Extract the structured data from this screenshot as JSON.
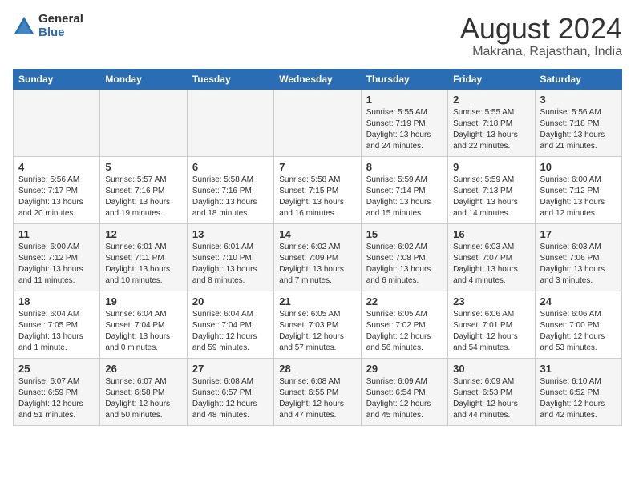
{
  "logo": {
    "general": "General",
    "blue": "Blue"
  },
  "header": {
    "title": "August 2024",
    "subtitle": "Makrana, Rajasthan, India"
  },
  "calendar": {
    "weekdays": [
      "Sunday",
      "Monday",
      "Tuesday",
      "Wednesday",
      "Thursday",
      "Friday",
      "Saturday"
    ],
    "weeks": [
      [
        {
          "day": "",
          "info": ""
        },
        {
          "day": "",
          "info": ""
        },
        {
          "day": "",
          "info": ""
        },
        {
          "day": "",
          "info": ""
        },
        {
          "day": "1",
          "info": "Sunrise: 5:55 AM\nSunset: 7:19 PM\nDaylight: 13 hours\nand 24 minutes."
        },
        {
          "day": "2",
          "info": "Sunrise: 5:55 AM\nSunset: 7:18 PM\nDaylight: 13 hours\nand 22 minutes."
        },
        {
          "day": "3",
          "info": "Sunrise: 5:56 AM\nSunset: 7:18 PM\nDaylight: 13 hours\nand 21 minutes."
        }
      ],
      [
        {
          "day": "4",
          "info": "Sunrise: 5:56 AM\nSunset: 7:17 PM\nDaylight: 13 hours\nand 20 minutes."
        },
        {
          "day": "5",
          "info": "Sunrise: 5:57 AM\nSunset: 7:16 PM\nDaylight: 13 hours\nand 19 minutes."
        },
        {
          "day": "6",
          "info": "Sunrise: 5:58 AM\nSunset: 7:16 PM\nDaylight: 13 hours\nand 18 minutes."
        },
        {
          "day": "7",
          "info": "Sunrise: 5:58 AM\nSunset: 7:15 PM\nDaylight: 13 hours\nand 16 minutes."
        },
        {
          "day": "8",
          "info": "Sunrise: 5:59 AM\nSunset: 7:14 PM\nDaylight: 13 hours\nand 15 minutes."
        },
        {
          "day": "9",
          "info": "Sunrise: 5:59 AM\nSunset: 7:13 PM\nDaylight: 13 hours\nand 14 minutes."
        },
        {
          "day": "10",
          "info": "Sunrise: 6:00 AM\nSunset: 7:12 PM\nDaylight: 13 hours\nand 12 minutes."
        }
      ],
      [
        {
          "day": "11",
          "info": "Sunrise: 6:00 AM\nSunset: 7:12 PM\nDaylight: 13 hours\nand 11 minutes."
        },
        {
          "day": "12",
          "info": "Sunrise: 6:01 AM\nSunset: 7:11 PM\nDaylight: 13 hours\nand 10 minutes."
        },
        {
          "day": "13",
          "info": "Sunrise: 6:01 AM\nSunset: 7:10 PM\nDaylight: 13 hours\nand 8 minutes."
        },
        {
          "day": "14",
          "info": "Sunrise: 6:02 AM\nSunset: 7:09 PM\nDaylight: 13 hours\nand 7 minutes."
        },
        {
          "day": "15",
          "info": "Sunrise: 6:02 AM\nSunset: 7:08 PM\nDaylight: 13 hours\nand 6 minutes."
        },
        {
          "day": "16",
          "info": "Sunrise: 6:03 AM\nSunset: 7:07 PM\nDaylight: 13 hours\nand 4 minutes."
        },
        {
          "day": "17",
          "info": "Sunrise: 6:03 AM\nSunset: 7:06 PM\nDaylight: 13 hours\nand 3 minutes."
        }
      ],
      [
        {
          "day": "18",
          "info": "Sunrise: 6:04 AM\nSunset: 7:05 PM\nDaylight: 13 hours\nand 1 minute."
        },
        {
          "day": "19",
          "info": "Sunrise: 6:04 AM\nSunset: 7:04 PM\nDaylight: 13 hours\nand 0 minutes."
        },
        {
          "day": "20",
          "info": "Sunrise: 6:04 AM\nSunset: 7:04 PM\nDaylight: 12 hours\nand 59 minutes."
        },
        {
          "day": "21",
          "info": "Sunrise: 6:05 AM\nSunset: 7:03 PM\nDaylight: 12 hours\nand 57 minutes."
        },
        {
          "day": "22",
          "info": "Sunrise: 6:05 AM\nSunset: 7:02 PM\nDaylight: 12 hours\nand 56 minutes."
        },
        {
          "day": "23",
          "info": "Sunrise: 6:06 AM\nSunset: 7:01 PM\nDaylight: 12 hours\nand 54 minutes."
        },
        {
          "day": "24",
          "info": "Sunrise: 6:06 AM\nSunset: 7:00 PM\nDaylight: 12 hours\nand 53 minutes."
        }
      ],
      [
        {
          "day": "25",
          "info": "Sunrise: 6:07 AM\nSunset: 6:59 PM\nDaylight: 12 hours\nand 51 minutes."
        },
        {
          "day": "26",
          "info": "Sunrise: 6:07 AM\nSunset: 6:58 PM\nDaylight: 12 hours\nand 50 minutes."
        },
        {
          "day": "27",
          "info": "Sunrise: 6:08 AM\nSunset: 6:57 PM\nDaylight: 12 hours\nand 48 minutes."
        },
        {
          "day": "28",
          "info": "Sunrise: 6:08 AM\nSunset: 6:55 PM\nDaylight: 12 hours\nand 47 minutes."
        },
        {
          "day": "29",
          "info": "Sunrise: 6:09 AM\nSunset: 6:54 PM\nDaylight: 12 hours\nand 45 minutes."
        },
        {
          "day": "30",
          "info": "Sunrise: 6:09 AM\nSunset: 6:53 PM\nDaylight: 12 hours\nand 44 minutes."
        },
        {
          "day": "31",
          "info": "Sunrise: 6:10 AM\nSunset: 6:52 PM\nDaylight: 12 hours\nand 42 minutes."
        }
      ]
    ]
  }
}
